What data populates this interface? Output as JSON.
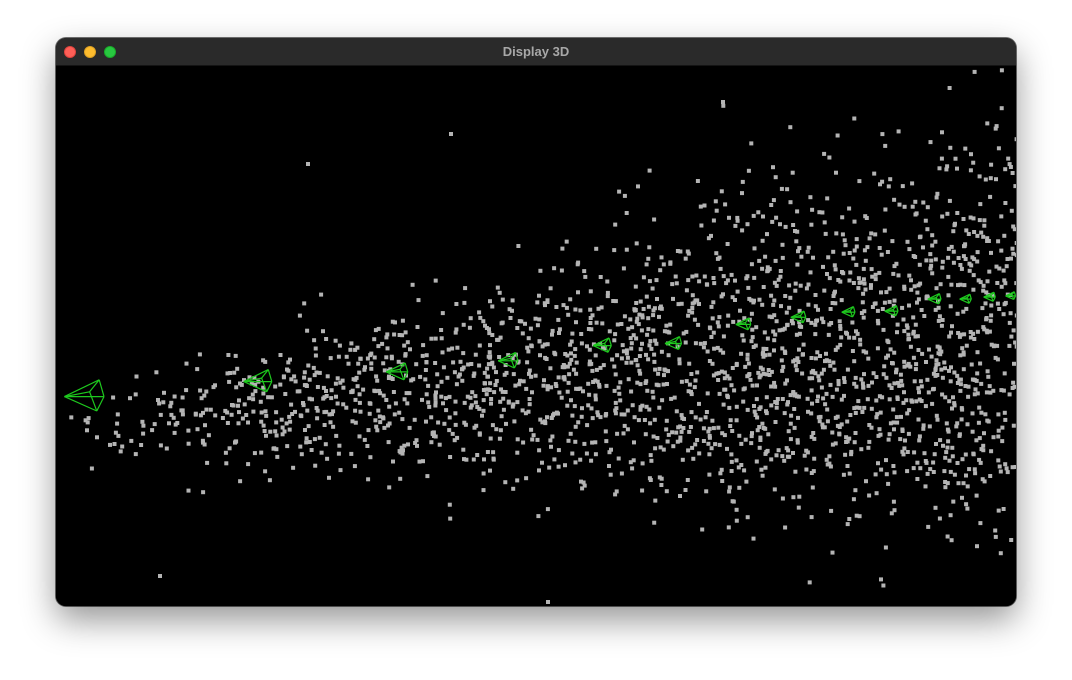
{
  "window": {
    "title": "Display 3D",
    "controls": [
      "close",
      "minimize",
      "zoom"
    ]
  },
  "scene": {
    "background_color": "#000000",
    "point_color": "#b4b4b4",
    "camera_color": "#1ec81e",
    "camera_count": 14,
    "point_count": 2300
  }
}
